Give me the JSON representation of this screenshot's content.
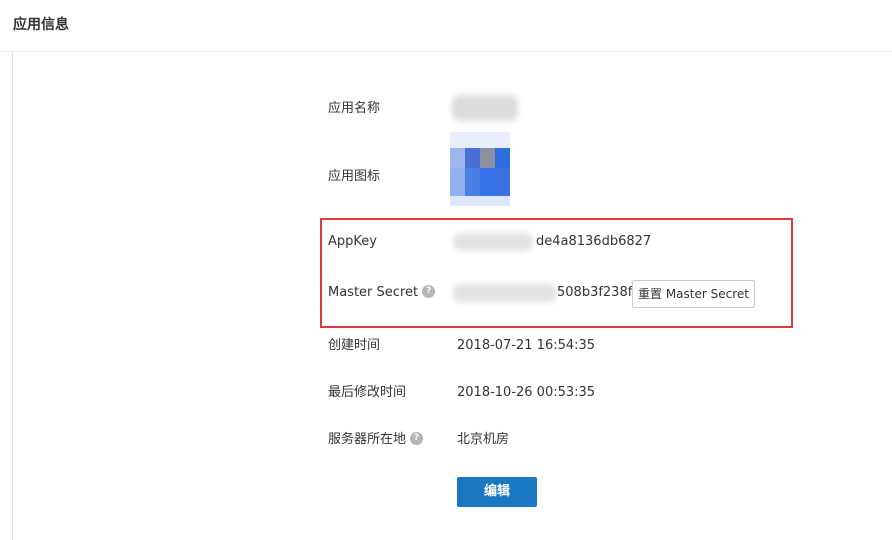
{
  "header": {
    "title": "应用信息"
  },
  "fields": {
    "app_name": {
      "label": "应用名称"
    },
    "app_icon": {
      "label": "应用图标"
    },
    "app_key": {
      "label": "AppKey",
      "value_visible": "de4a8136db6827"
    },
    "master_secret": {
      "label": "Master Secret",
      "help": "?",
      "value_visible": "508b3f238f"
    },
    "created_time": {
      "label": "创建时间",
      "value": "2018-07-21 16:54:35"
    },
    "modified_time": {
      "label": "最后修改时间",
      "value": "2018-10-26 00:53:35"
    },
    "server_location": {
      "label": "服务器所在地",
      "help": "?",
      "value": "北京机房"
    }
  },
  "buttons": {
    "reset_master_secret": "重置 Master Secret",
    "edit": "编辑"
  },
  "icons": {
    "help": "question-circle-icon",
    "app_icon": "app-icon-mosaic"
  },
  "colors": {
    "primary": "#1a78c2",
    "highlight_border": "#e0393e",
    "help_icon_bg": "#b5b5b5",
    "text": "#333333",
    "icon_blue": "#3a73e0"
  }
}
